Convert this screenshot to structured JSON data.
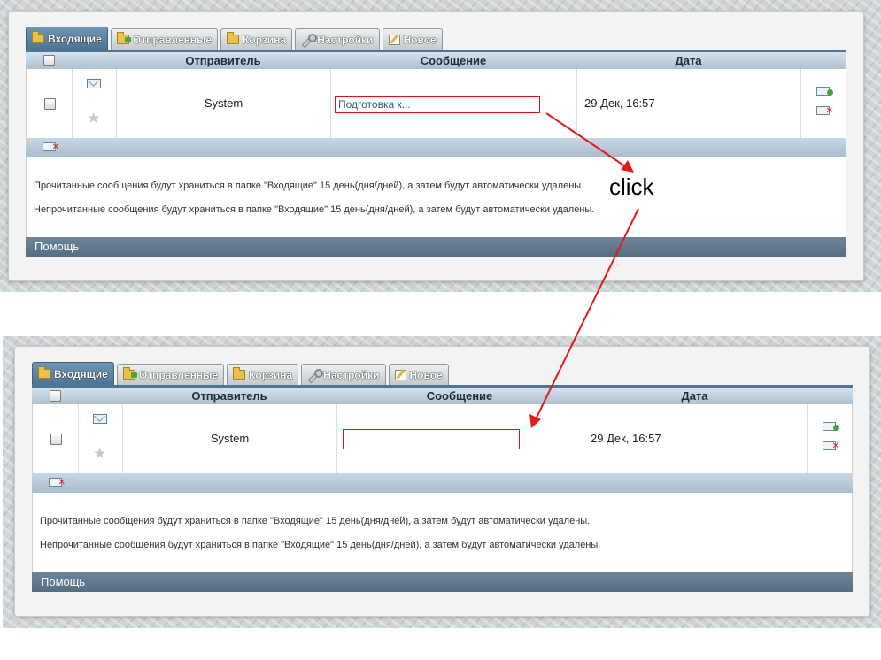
{
  "tabs": [
    {
      "label": "Входящие",
      "icon": "inbox-folder-icon",
      "active": true
    },
    {
      "label": "Отправленные",
      "icon": "sent-folder-icon",
      "active": false
    },
    {
      "label": "Корзина",
      "icon": "trash-folder-icon",
      "active": false
    },
    {
      "label": "Настройки",
      "icon": "wrench-icon",
      "active": false
    },
    {
      "label": "Новое",
      "icon": "compose-icon",
      "active": false
    }
  ],
  "table": {
    "columns": [
      "Отправитель",
      "Сообщение",
      "Дата"
    ]
  },
  "before": {
    "row": {
      "sender": "System",
      "message": "Подготовка к...",
      "date": "29 Дек, 16:57"
    }
  },
  "after": {
    "row": {
      "sender": "System",
      "message": "",
      "date": "29 Дек, 16:57"
    }
  },
  "info": {
    "read_notice": "Прочитанные сообщения будут храниться в папке \"Входящие\" 15 день(дня/дней), а затем будут автоматически удалены.",
    "unread_notice": "Непрочитанные сообщения будут храниться в папке \"Входящие\" 15 день(дня/дней), а затем будут автоматически удалены."
  },
  "footer": {
    "help": "Помощь"
  },
  "annotation": {
    "label": "click",
    "color": "#e01b1b"
  },
  "colors": {
    "accent": "#4d7596",
    "highlight": "#d9151b",
    "footer": "#5f7689"
  }
}
